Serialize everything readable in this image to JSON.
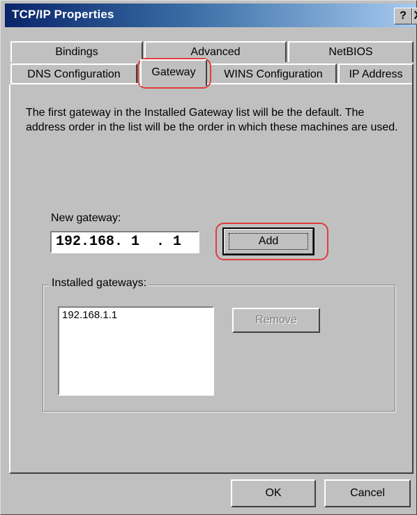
{
  "window": {
    "title": "TCP/IP Properties",
    "help_label": "?",
    "close_label": "X"
  },
  "tabs": {
    "row1": [
      "Bindings",
      "Advanced",
      "NetBIOS"
    ],
    "row2": [
      "DNS Configuration",
      "Gateway",
      "WINS Configuration",
      "IP Address"
    ],
    "active": "Gateway"
  },
  "gateway_page": {
    "description": "The first gateway in the Installed Gateway list will be the default. The address order in the list will be the order in which these machines are used.",
    "new_gateway_label": "New gateway:",
    "new_gateway_value": "192.168. 1  . 1",
    "add_button": "Add",
    "installed_label": "Installed gateways:",
    "installed_items": [
      "192.168.1.1"
    ],
    "remove_button": "Remove"
  },
  "footer": {
    "ok_button": "OK",
    "cancel_button": "Cancel"
  },
  "colors": {
    "face": "#c0c0c0",
    "title_start": "#0a246a",
    "title_end": "#a6caf0",
    "highlight_ring": "#e03c3c"
  }
}
